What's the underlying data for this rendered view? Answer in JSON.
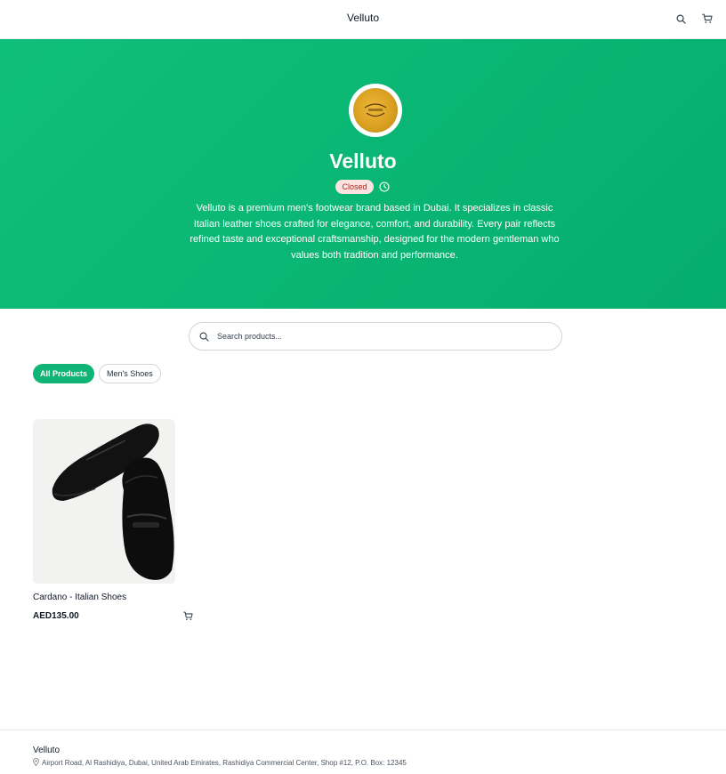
{
  "header": {
    "title": "Velluto",
    "search_icon": "search-icon",
    "cart_icon": "cart-icon"
  },
  "hero": {
    "store_name": "Velluto",
    "status": "Closed",
    "description": "Velluto is a premium men's footwear brand based in Dubai. It specializes in classic Italian leather shoes crafted for elegance, comfort, and durability. Every pair reflects refined taste and exceptional craftsmanship, designed for the modern gentleman who values both tradition and performance.",
    "background_color": "#0ebf79"
  },
  "search": {
    "placeholder": "Search products..."
  },
  "categories": [
    {
      "label": "All Products",
      "active": true
    },
    {
      "label": "Men's Shoes",
      "active": false
    }
  ],
  "products": [
    {
      "name": "Cardano - Italian Shoes",
      "price": "AED135.00"
    }
  ],
  "footer": {
    "name": "Velluto",
    "address": "Airport Road, Al Rashidiya, Dubai, United Arab Emirates, Rashidiya Commercial Center, Shop #12, P.O. Box: 12345"
  },
  "colors": {
    "accent": "#10b575",
    "badge_bg": "#fde2e2",
    "badge_text": "#b42318"
  }
}
